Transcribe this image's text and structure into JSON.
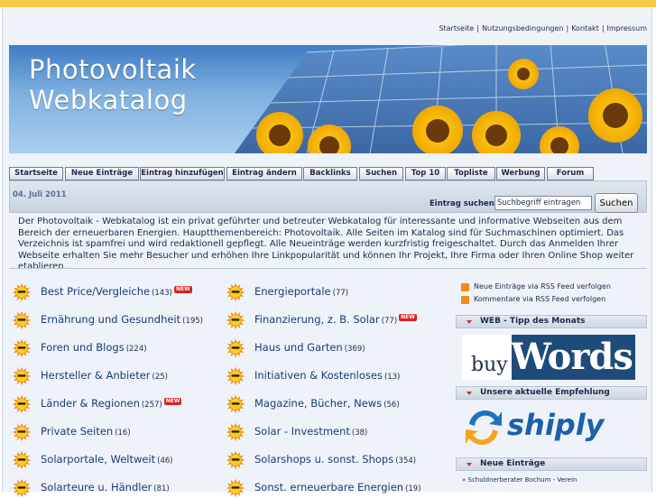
{
  "header": {
    "top_links": [
      "Startseite",
      "Nutzungsbedingungen",
      "Kontakt",
      "Impressum"
    ],
    "banner_line1": "Photovoltaik",
    "banner_line2": "Webkatalog"
  },
  "nav": {
    "tabs": [
      "Startseite",
      "Neue Einträge",
      "Eintrag hinzufügen",
      "Eintrag ändern",
      "Backlinks",
      "Suchen",
      "Top 10",
      "Topliste",
      "Werbung",
      "Forum"
    ]
  },
  "subbar": {
    "date": "04. Juli 2011",
    "search_label": "Eintrag suchen:",
    "search_value": "Suchbegriff eintragen",
    "search_button": "Suchen"
  },
  "intro": "Der Photovoltaik - Webkatalog ist ein privat geführter und betreuter Webkatalog für interessante und informative Webseiten aus dem Bereich der erneuerbaren Energien. Hauptthemenbereich: Photovoltaik. Alle Seiten im Katalog sind für Suchmaschinen optimiert. Das Verzeichnis ist spamfrei und wird redaktionell gepflegt. Alle Neueinträge werden kurzfristig freigeschaltet. Durch das Anmelden Ihrer Webseite erhalten Sie mehr Besucher und erhöhen Ihre Linkpopularität und können Ihr Projekt, Ihre Firma oder Ihren Online Shop weiter etablieren.",
  "categories_left": [
    {
      "name": "Best Price/Vergleiche",
      "count": "(143)",
      "new": true
    },
    {
      "name": "Ernährung und Gesundheit",
      "count": "(195)",
      "new": false
    },
    {
      "name": "Foren und Blogs",
      "count": "(224)",
      "new": false
    },
    {
      "name": "Hersteller & Anbieter",
      "count": "(25)",
      "new": false
    },
    {
      "name": "Länder & Regionen",
      "count": "(257)",
      "new": true
    },
    {
      "name": "Private Seiten",
      "count": "(16)",
      "new": false
    },
    {
      "name": "Solarportale, Weltweit",
      "count": "(46)",
      "new": false
    },
    {
      "name": "Solarteure u. Händler",
      "count": "(81)",
      "new": false
    }
  ],
  "categories_right": [
    {
      "name": "Energieportale",
      "count": "(77)",
      "new": false
    },
    {
      "name": "Finanzierung, z. B. Solar",
      "count": "(77)",
      "new": true
    },
    {
      "name": "Haus und Garten",
      "count": "(369)",
      "new": false
    },
    {
      "name": "Initiativen & Kostenloses",
      "count": "(13)",
      "new": false
    },
    {
      "name": "Magazine, Bücher, News",
      "count": "(56)",
      "new": false
    },
    {
      "name": "Solar - Investment",
      "count": "(38)",
      "new": false
    },
    {
      "name": "Solarshops u. sonst. Shops",
      "count": "(354)",
      "new": false
    },
    {
      "name": "Sonst. erneuerbare Energien",
      "count": "(19)",
      "new": false
    }
  ],
  "new_badge": "NEW",
  "sidebar": {
    "rss": [
      "Neue Einträge via RSS Feed verfolgen",
      "Kommentare via RSS Feed verfolgen"
    ],
    "web_tipp_title": "WEB - Tipp des Monats",
    "buywords_1": "buy",
    "buywords_2": "Words",
    "empfehlung_title": "Unsere aktuelle Empfehlung",
    "shiply": "shiply",
    "neue_eintraege_title": "Neue Einträge",
    "neue_eintraege_item": "Schuldnerberater Bochum - Verein"
  },
  "colors": {
    "accent": "#f7c948",
    "link": "#1a3a78",
    "new_badge": "#e02020"
  }
}
